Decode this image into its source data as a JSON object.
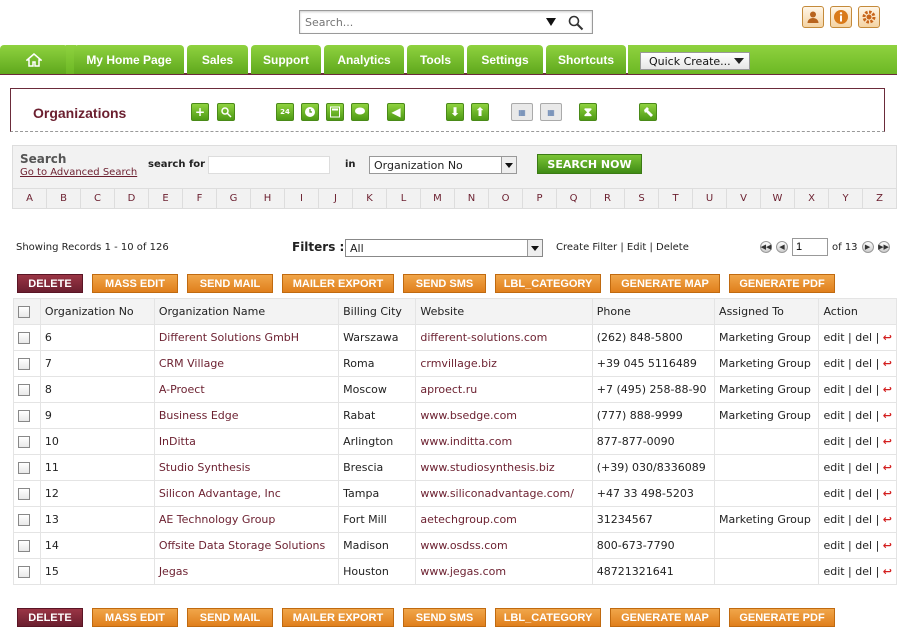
{
  "search": {
    "placeholder": "Search..."
  },
  "tabs": [
    "My Home Page",
    "Sales",
    "Support",
    "Analytics",
    "Tools",
    "Settings",
    "Shortcuts"
  ],
  "quick_create": "Quick Create...",
  "module": {
    "title": "Organizations"
  },
  "search_panel": {
    "title": "Search",
    "advanced_link": "Go to Advanced Search",
    "for_label": "search for",
    "in_label": "in",
    "field_value": "Organization No",
    "button": "SEARCH NOW",
    "letters": [
      "A",
      "B",
      "C",
      "D",
      "E",
      "F",
      "G",
      "H",
      "I",
      "J",
      "K",
      "L",
      "M",
      "N",
      "O",
      "P",
      "Q",
      "R",
      "S",
      "T",
      "U",
      "V",
      "W",
      "X",
      "Y",
      "Z"
    ]
  },
  "records": {
    "showing": "Showing Records 1 - 10 of 126",
    "filters_label": "Filters :",
    "filter_value": "All",
    "create_filter": "Create Filter",
    "edit": "Edit",
    "delete": "Delete",
    "sep": " | ",
    "page": "1",
    "of_pages": "of 13"
  },
  "actions": [
    "DELETE",
    "MASS EDIT",
    "SEND MAIL",
    "MAILER EXPORT",
    "SEND SMS",
    "LBL_CATEGORY",
    "GENERATE MAP",
    "GENERATE PDF"
  ],
  "table": {
    "columns": [
      "Organization No",
      "Organization Name",
      "Billing City",
      "Website",
      "Phone",
      "Assigned To",
      "Action"
    ],
    "rows": [
      [
        "6",
        "Different Solutions GmbH",
        "Warszawa",
        "different-solutions.com",
        "(262) 848-5800",
        "Marketing Group"
      ],
      [
        "7",
        "CRM Village",
        "Roma",
        "crmvillage.biz",
        "+39 045 5116489",
        "Marketing Group"
      ],
      [
        "8",
        "A-Proect",
        "Moscow",
        "aproect.ru",
        "+7 (495) 258-88-90",
        "Marketing Group"
      ],
      [
        "9",
        "Business Edge",
        "Rabat",
        "www.bsedge.com",
        "(777) 888-9999",
        "Marketing Group"
      ],
      [
        "10",
        "InDitta",
        "Arlington",
        "www.inditta.com",
        "877-877-0090",
        ""
      ],
      [
        "11",
        "Studio Synthesis",
        "Brescia",
        "www.studiosynthesis.biz",
        "(+39) 030/8336089",
        ""
      ],
      [
        "12",
        "Silicon Advantage, Inc",
        "Tampa",
        "www.siliconadvantage.com/",
        "+47 33 498-5203",
        ""
      ],
      [
        "13",
        "AE Technology Group",
        "Fort Mill",
        "aetechgroup.com",
        "31234567",
        "Marketing Group"
      ],
      [
        "14",
        "Offsite Data Storage Solutions",
        "Madison",
        "www.osdss.com",
        "800-673-7790",
        ""
      ],
      [
        "15",
        "Jegas",
        "Houston",
        "www.jegas.com",
        "48721321641",
        ""
      ]
    ],
    "row_action": {
      "edit": "edit",
      "del": "del",
      "sep": " | "
    }
  }
}
